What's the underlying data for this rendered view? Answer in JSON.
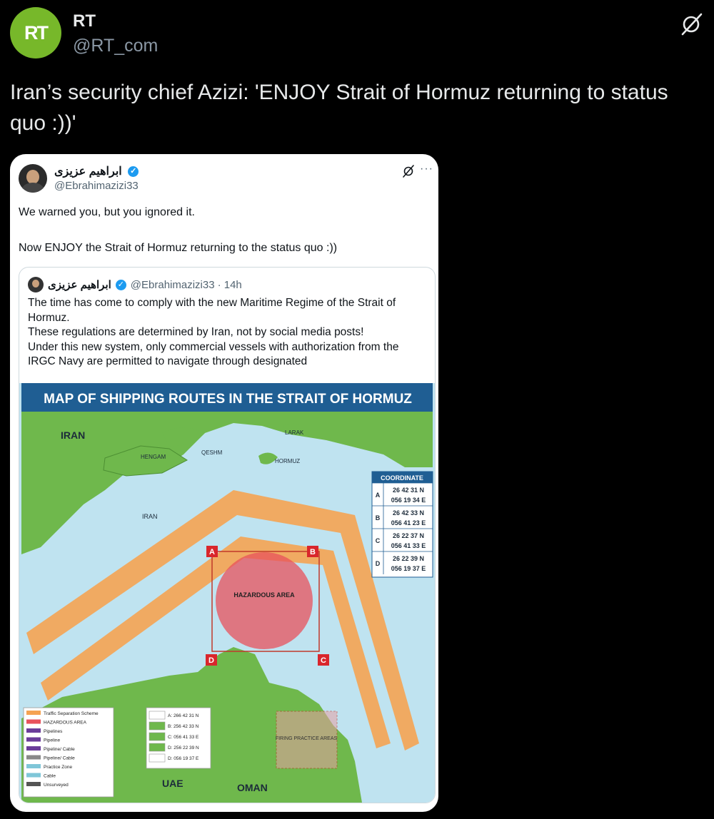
{
  "post": {
    "author_name": "RT",
    "author_handle": "@RT_com",
    "avatar_text": "RT",
    "text": "Iran’s security chief Azizi: 'ENJOY Strait of Hormuz returning to status quo :))'"
  },
  "embedded": {
    "author_name": "ابراهیم عزیزی",
    "author_handle": "@Ebrahimazizi33",
    "line1": "We warned you, but you ignored it.",
    "line2": "Now ENJOY the Strait of Hormuz returning to the status quo :))",
    "more": "···",
    "quote": {
      "author_name": "ابراهیم عزیزی",
      "author_handle": "@Ebrahimazizi33",
      "time": "· 14h",
      "text": "The time has come to comply with the new Maritime Regime of the Strait of Hormuz.\nThese regulations are determined by Iran, not by social media posts!\nUnder this new system, only commercial vessels with authorization from the IRGC Navy are permitted to navigate through designated"
    }
  },
  "map": {
    "title": "MAP OF SHIPPING ROUTES IN THE STRAIT OF HORMUZ",
    "places": {
      "iran": "IRAN",
      "hengam": "HENGAM",
      "qeshm": "QESHM",
      "larak": "LARAK",
      "hormuz": "HORMUZ",
      "iran_small": "IRAN",
      "uae": "UAE",
      "oman": "OMAN",
      "hazard": "HAZARDOUS AREA",
      "firing": "FIRING PRACTICE AREAS"
    },
    "coordinate_title": "COORDINATE",
    "coordinates": [
      {
        "label": "A",
        "n": "26 42 31 N",
        "e": "056 19 34 E"
      },
      {
        "label": "B",
        "n": "26 42 33 N",
        "e": "056 41 23 E"
      },
      {
        "label": "C",
        "n": "26 22 37 N",
        "e": "056 41 33 E"
      },
      {
        "label": "D",
        "n": "26 22 39 N",
        "e": "056 19 37 E"
      }
    ],
    "legend_left": [
      "Traffic Separation Scheme",
      "HAZARDOUS AREA",
      "Pipelines",
      "Pipeline",
      "Pipeline/ Cable",
      "Pipeline/ Cable",
      "Practice Zone",
      "Cable",
      "Unsurveyed"
    ],
    "legend_right": [
      "A: 266 42 31 N",
      "B: 256 42 33 N",
      "C: 056 41 33 E",
      "D: 256 22 39 N",
      "D: 056 19 37 E"
    ],
    "colors": {
      "sea": "#bfe3f0",
      "land": "#6fb84c",
      "route": "#f5a352",
      "hazard": "#e8525c",
      "header": "#1f5e93"
    }
  }
}
